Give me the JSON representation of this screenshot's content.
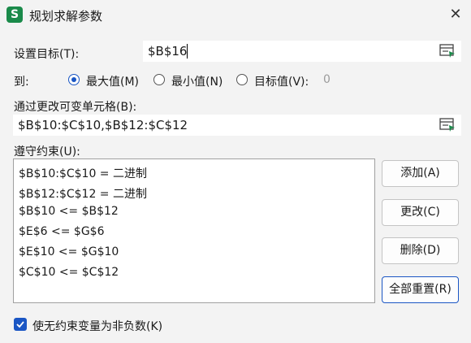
{
  "window": {
    "title": "规划求解参数",
    "app_icon_letter": "S"
  },
  "objective": {
    "label": "设置目标(T):",
    "value": "$B$16"
  },
  "to": {
    "label": "到:",
    "options": [
      {
        "label": "最大值(M)",
        "selected": true
      },
      {
        "label": "最小值(N)",
        "selected": false
      },
      {
        "label": "目标值(V):",
        "selected": false
      }
    ],
    "target_value": "0"
  },
  "variables": {
    "label": "通过更改可变单元格(B):",
    "value": "$B$10:$C$10,$B$12:$C$12"
  },
  "constraints": {
    "label": "遵守约束(U):",
    "items": [
      "$B$10:$C$10 = 二进制",
      "$B$12:$C$12 = 二进制",
      "$B$10 <= $B$12",
      "$E$6 <= $G$6",
      "$E$10 <= $G$10",
      "$C$10 <= $C$12"
    ]
  },
  "buttons": {
    "add": "添加(A)",
    "change": "更改(C)",
    "delete": "删除(D)",
    "reset_all": "全部重置(R)"
  },
  "nonneg": {
    "label": "使无约束变量为非负数(K)",
    "checked": true
  },
  "colors": {
    "accent": "#1a56c4",
    "app_icon": "#1a8a4a"
  }
}
